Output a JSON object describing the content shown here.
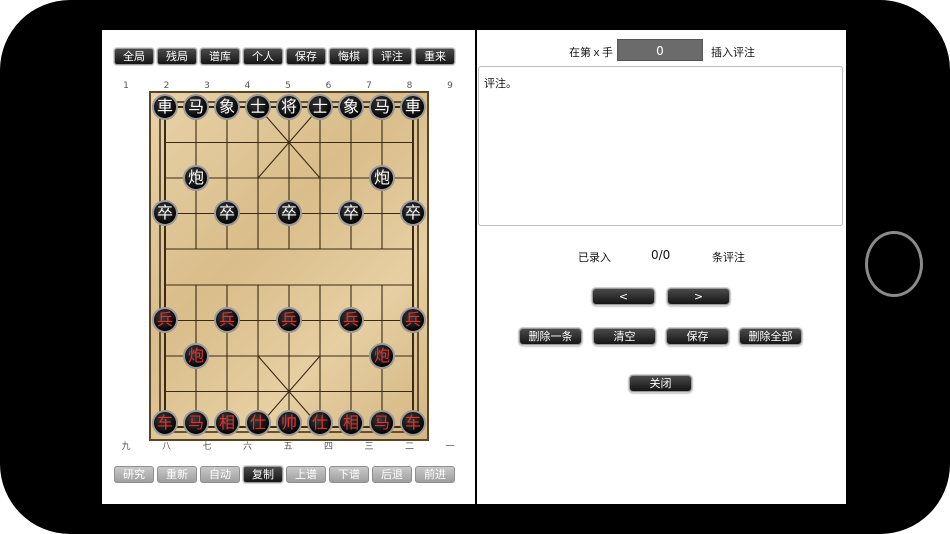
{
  "top_toolbar": [
    "全局",
    "残局",
    "谱库",
    "个人",
    "保存",
    "悔棋",
    "评注",
    "重来"
  ],
  "bottom_toolbar": [
    {
      "label": "研究",
      "style": "light"
    },
    {
      "label": "重新",
      "style": "light"
    },
    {
      "label": "自动",
      "style": "light"
    },
    {
      "label": "复制",
      "style": "dark"
    },
    {
      "label": "上谱",
      "style": "light"
    },
    {
      "label": "下谱",
      "style": "light"
    },
    {
      "label": "后退",
      "style": "light"
    },
    {
      "label": "前进",
      "style": "light"
    }
  ],
  "file_labels_top": [
    "1",
    "2",
    "3",
    "4",
    "5",
    "6",
    "7",
    "8",
    "9"
  ],
  "file_labels_bottom": [
    "九",
    "八",
    "七",
    "六",
    "五",
    "四",
    "三",
    "二",
    "一"
  ],
  "board": {
    "black_back_rank": [
      "車",
      "马",
      "象",
      "士",
      "将",
      "士",
      "象",
      "马",
      "車"
    ],
    "black_cannon": "炮",
    "black_soldier": "卒",
    "red_back_rank": [
      "车",
      "马",
      "相",
      "仕",
      "帅",
      "仕",
      "相",
      "马",
      "车"
    ],
    "red_cannon": "炮",
    "red_soldier": "兵"
  },
  "comment_panel": {
    "move_prefix": "在第ｘ手",
    "move_number": "0",
    "insert_label": "插入评注",
    "comment_text": "评注。",
    "recorded_label": "已录入",
    "count": "0/0",
    "count_suffix": "条评注",
    "prev_button": "<",
    "next_button": ">",
    "delete_one": "删除一条",
    "clear": "清空",
    "save": "保存",
    "delete_all": "删除全部",
    "close": "关闭"
  }
}
